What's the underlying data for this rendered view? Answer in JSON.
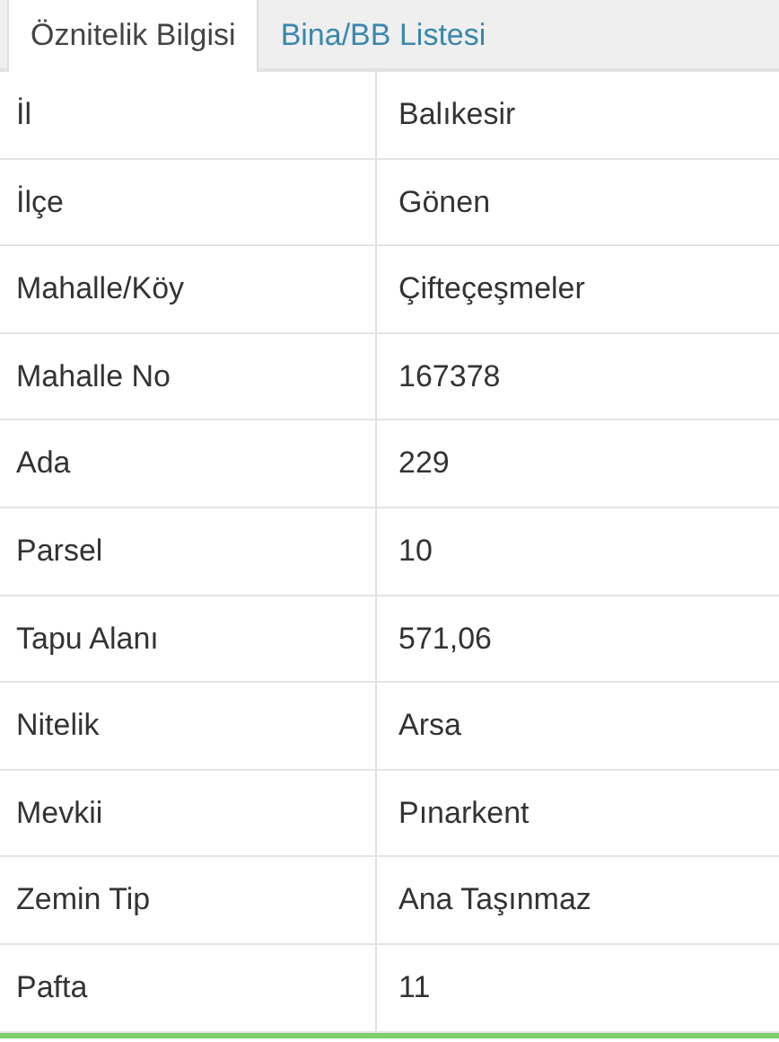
{
  "tabs": [
    {
      "label": "Öznitelik Bilgisi",
      "selected": true
    },
    {
      "label": "Bina/BB Listesi",
      "selected": false
    }
  ],
  "rows": [
    {
      "field": "İl",
      "value": "Balıkesir"
    },
    {
      "field": "İlçe",
      "value": "Gönen"
    },
    {
      "field": "Mahalle/Köy",
      "value": "Çifteçeşmeler"
    },
    {
      "field": "Mahalle No",
      "value": "167378"
    },
    {
      "field": "Ada",
      "value": "229"
    },
    {
      "field": "Parsel",
      "value": "10"
    },
    {
      "field": "Tapu Alanı",
      "value": "571,06"
    },
    {
      "field": "Nitelik",
      "value": "Arsa"
    },
    {
      "field": "Mevkii",
      "value": "Pınarkent"
    },
    {
      "field": "Zemin Tip",
      "value": "Ana Taşınmaz"
    },
    {
      "field": "Pafta",
      "value": "11"
    }
  ]
}
